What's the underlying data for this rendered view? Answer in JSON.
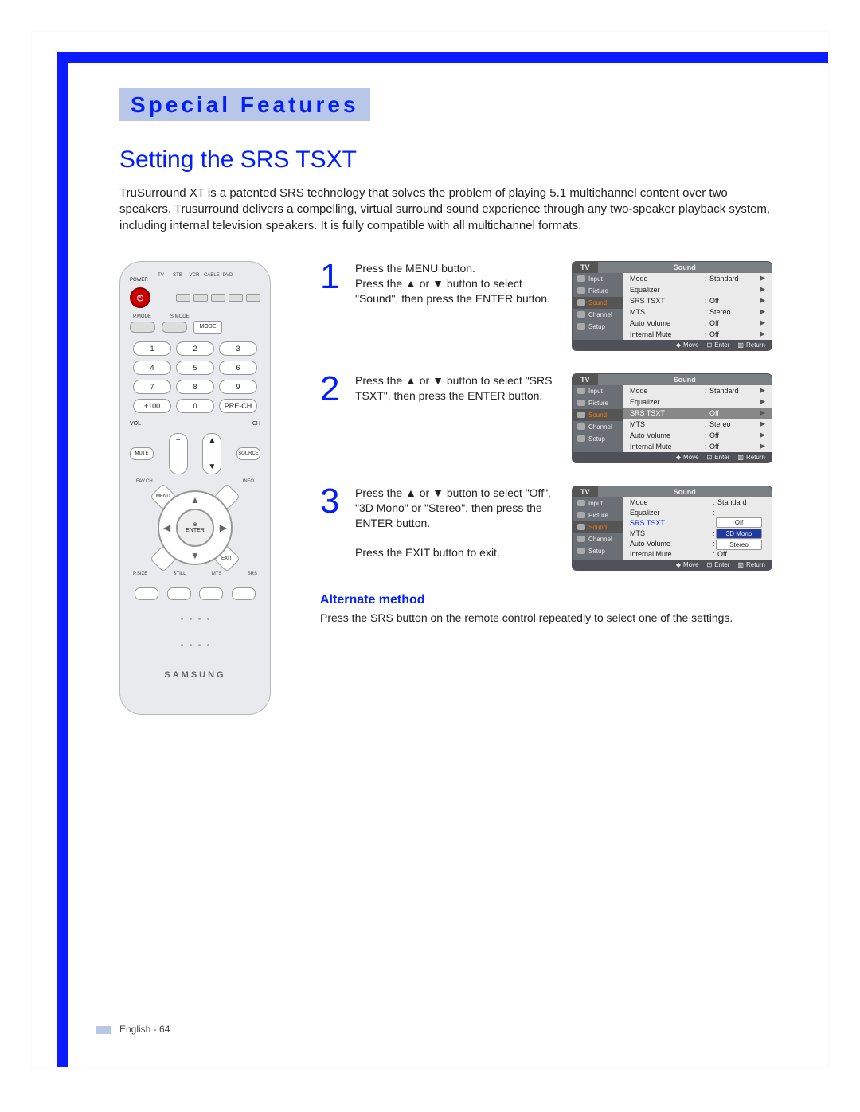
{
  "chapter": "Special Features",
  "title": "Setting the SRS TSXT",
  "intro": "TruSurround XT is a patented SRS technology that solves the problem of playing 5.1 multichannel content over two speakers. Trusurround delivers a compelling, virtual surround sound experience through any two-speaker playback system, including internal television speakers. It is fully compatible with all multichannel formats.",
  "remote": {
    "power_label": "POWER",
    "srcLabels": [
      "TV",
      "STB",
      "VCR",
      "CABLE",
      "DVD"
    ],
    "pmode": "P.MODE",
    "smode": "S.MODE",
    "mode": "MODE",
    "numbers": [
      "1",
      "2",
      "3",
      "4",
      "5",
      "6",
      "7",
      "8",
      "9",
      "+100",
      "0",
      "PRE-CH"
    ],
    "vol": "VOL",
    "ch": "CH",
    "mute": "MUTE",
    "source": "SOURCE",
    "menu": "MENU",
    "favch": "FAV.CH",
    "info": "INFO",
    "exit": "EXIT",
    "enter": "ENTER",
    "bottomLabels": [
      "P.SIZE",
      "STILL",
      "MTS",
      "SRS"
    ],
    "brand": "SAMSUNG"
  },
  "steps": [
    {
      "n": "1",
      "text": "Press the MENU button.\nPress the ▲ or ▼ button to select \"Sound\", then press the ENTER button."
    },
    {
      "n": "2",
      "text": "Press the ▲ or ▼ button to select \"SRS TSXT\", then press the ENTER button."
    },
    {
      "n": "3",
      "text": "Press the ▲ or ▼ button to select \"Off\", \"3D Mono\" or \"Stereo\", then press the ENTER button.\n\nPress the EXIT button to exit."
    }
  ],
  "osdCommon": {
    "tv": "TV",
    "title": "Sound",
    "side": [
      "Input",
      "Picture",
      "Sound",
      "Channel",
      "Setup"
    ],
    "footer": {
      "move": "Move",
      "enter": "Enter",
      "return": "Return"
    }
  },
  "osd1": {
    "rows": [
      {
        "k": "Mode",
        "v": "Standard",
        "ar": "▶"
      },
      {
        "k": "Equalizer",
        "v": "",
        "ar": "▶"
      },
      {
        "k": "SRS TSXT",
        "v": "Off",
        "ar": "▶"
      },
      {
        "k": "MTS",
        "v": "Stereo",
        "ar": "▶"
      },
      {
        "k": "Auto Volume",
        "v": "Off",
        "ar": "▶"
      },
      {
        "k": "Internal Mute",
        "v": "Off",
        "ar": "▶"
      }
    ]
  },
  "osd2": {
    "rows": [
      {
        "k": "Mode",
        "v": "Standard",
        "ar": "▶"
      },
      {
        "k": "Equalizer",
        "v": "",
        "ar": "▶"
      },
      {
        "k": "SRS TSXT",
        "v": "Off",
        "ar": "▶",
        "hl": true
      },
      {
        "k": "MTS",
        "v": "Stereo",
        "ar": "▶"
      },
      {
        "k": "Auto Volume",
        "v": "Off",
        "ar": "▶"
      },
      {
        "k": "Internal Mute",
        "v": "Off",
        "ar": "▶"
      }
    ]
  },
  "osd3": {
    "rows": [
      {
        "k": "Mode",
        "v": "Standard"
      },
      {
        "k": "Equalizer",
        "v": ""
      },
      {
        "k": "SRS TSXT",
        "v": "",
        "blue": true,
        "opts": [
          "Off",
          "3D Mono",
          "Stereo"
        ],
        "sel": "3D Mono"
      },
      {
        "k": "MTS",
        "v": ""
      },
      {
        "k": "Auto Volume",
        "v": ""
      },
      {
        "k": "Internal Mute",
        "v": "Off"
      }
    ]
  },
  "alt": {
    "head": "Alternate method",
    "text": "Press the SRS button on the remote control repeatedly to select one of the settings."
  },
  "footer": "English - 64"
}
